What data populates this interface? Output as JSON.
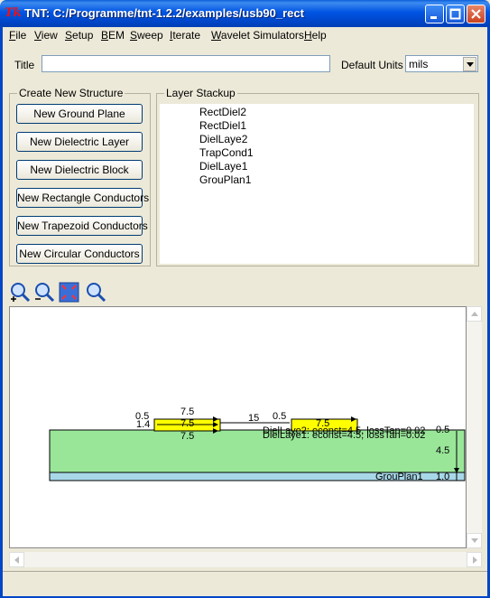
{
  "window": {
    "title": "TNT:  C:/Programme/tnt-1.2.2/examples/usb90_rect",
    "app_icon": "Tk"
  },
  "menu": [
    "File",
    "View",
    "Setup",
    "BEM",
    "Sweep",
    "Iterate",
    "Wavelet Simulators",
    "Help"
  ],
  "form": {
    "title_label": "Title",
    "title_value": "",
    "units_label": "Default Units",
    "units_value": "mils"
  },
  "create": {
    "legend": "Create New Structure",
    "buttons": [
      "New Ground Plane",
      "New Dielectric Layer",
      "New Dielectric Block",
      "New Rectangle Conductors",
      "New Trapezoid Conductors",
      "New Circular Conductors"
    ]
  },
  "stackup": {
    "legend": "Layer Stackup",
    "items": [
      "RectDiel2",
      "RectDiel1",
      "DielLaye2",
      "TrapCond1",
      "DielLaye1",
      "GrouPlan1"
    ]
  },
  "toolbar": [
    "zoom-in-icon",
    "zoom-out-icon",
    "zoom-fit-icon",
    "zoom-icon"
  ],
  "canvas": {
    "dims": {
      "d15": "15",
      "d05a": "0.5",
      "d75a": "7.5",
      "d14": "1.4",
      "d75b": "7.5",
      "d75c": "7.5",
      "d05b": "0.5",
      "d75d": "7.5",
      "d05c": "0.5",
      "d45": "4.5",
      "d10": "1.0"
    },
    "layer_labels": {
      "diel_a": "DielLaye2: econst=4.5, lossTan=0.02",
      "diel_b": "DielLaye1: econst=4.5; lossTan=0.02",
      "ground": "GrouPlan1"
    },
    "colors": {
      "conductor": "#ffff00",
      "dielectric": "#99e699",
      "ground": "#a8d8e8"
    }
  }
}
